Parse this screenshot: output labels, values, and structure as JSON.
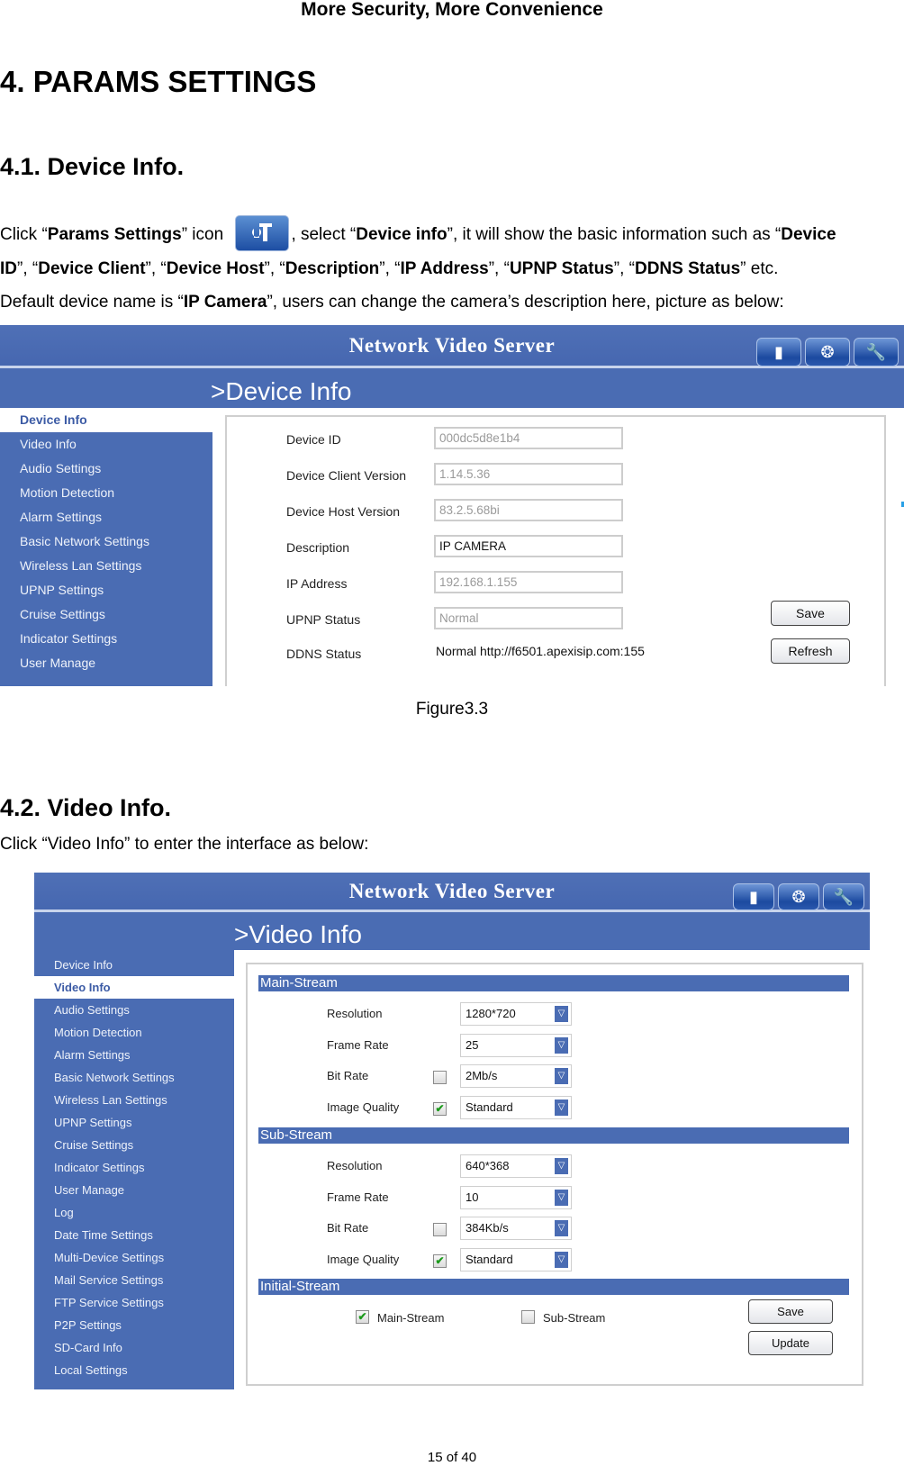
{
  "document": {
    "header": "More Security, More Convenience",
    "chapter_title": "4. PARAMS SETTINGS",
    "footer": "15 of 40"
  },
  "section1": {
    "title": "4.1. Device Info.",
    "para1": {
      "t1": "Click “",
      "b1": "Params Settings",
      "t2": "” icon ",
      "icon": "params-settings-icon",
      "t3": ", select “",
      "b2": "Device info",
      "t4": "”, it will show the basic information such as “",
      "b3": "Device"
    },
    "para2": {
      "b1": "ID",
      "t1": "”, “",
      "b2": "Device Client",
      "t2": "”, “",
      "b3": "Device Host",
      "t3": "”, “",
      "b4": "Description",
      "t4": "”, “",
      "b5": "IP Address",
      "t5": "”, “",
      "b6": "UPNP Status",
      "t6": "”, “",
      "b7": "DDNS Status",
      "t7": "” etc."
    },
    "para3": {
      "t1": "Default device name is “",
      "b1": "IP Camera",
      "t2": "”, users can change the camera’s description here, picture as below:"
    },
    "caption": "Figure3.3"
  },
  "section2": {
    "title": "4.2. Video Info.",
    "para": "Click “Video Info” to enter the interface as below:"
  },
  "app": {
    "title": "Network Video Server",
    "toolbar_icons": [
      "monitor-icon",
      "film-reel-icon",
      "tools-icon"
    ],
    "colors": {
      "primary": "#4a6cb3",
      "active_text": "#3c5ba5",
      "panel_border": "#cfcfcf"
    }
  },
  "figure1": {
    "section_title": ">Device Info",
    "sidebar": [
      "Device Info",
      "Video Info",
      "Audio Settings",
      "Motion Detection",
      "Alarm Settings",
      "Basic Network Settings",
      "Wireless Lan Settings",
      "UPNP Settings",
      "Cruise Settings",
      "Indicator Settings",
      "User Manage"
    ],
    "active_index": 0,
    "fields": [
      {
        "label": "Device ID",
        "value": "000dc5d8e1b4",
        "editable": false
      },
      {
        "label": "Device Client Version",
        "value": "1.14.5.36",
        "editable": false
      },
      {
        "label": "Device Host Version",
        "value": "83.2.5.68bi",
        "editable": false
      },
      {
        "label": "Description",
        "value": "IP CAMERA",
        "editable": true
      },
      {
        "label": "IP Address",
        "value": "192.168.1.155",
        "editable": false
      },
      {
        "label": "UPNP Status",
        "value": "Normal",
        "editable": false
      },
      {
        "label": "DDNS Status",
        "value": "Normal http://f6501.apexisip.com:155"
      }
    ],
    "buttons": {
      "save": "Save",
      "refresh": "Refresh"
    }
  },
  "figure2": {
    "section_title": ">Video Info",
    "sidebar": [
      "Device Info",
      "Video Info",
      "Audio Settings",
      "Motion Detection",
      "Alarm Settings",
      "Basic Network Settings",
      "Wireless Lan Settings",
      "UPNP Settings",
      "Cruise Settings",
      "Indicator Settings",
      "User Manage",
      "Log",
      "Date Time Settings",
      "Multi-Device Settings",
      "Mail Service Settings",
      "FTP Service Settings",
      "P2P Settings",
      "SD-Card Info",
      "Local Settings"
    ],
    "active_index": 1,
    "main_stream": {
      "title": "Main-Stream",
      "resolution": {
        "label": "Resolution",
        "value": "1280*720"
      },
      "frame_rate": {
        "label": "Frame Rate",
        "value": "25"
      },
      "bit_rate": {
        "label": "Bit Rate",
        "value": "2Mb/s",
        "checked": false
      },
      "image_quality": {
        "label": "Image Quality",
        "value": "Standard",
        "checked": true
      }
    },
    "sub_stream": {
      "title": "Sub-Stream",
      "resolution": {
        "label": "Resolution",
        "value": "640*368"
      },
      "frame_rate": {
        "label": "Frame Rate",
        "value": "10"
      },
      "bit_rate": {
        "label": "Bit Rate",
        "value": "384Kb/s",
        "checked": false
      },
      "image_quality": {
        "label": "Image Quality",
        "value": "Standard",
        "checked": true
      }
    },
    "initial_stream": {
      "title": "Initial-Stream",
      "main": {
        "label": "Main-Stream",
        "checked": true
      },
      "sub": {
        "label": "Sub-Stream",
        "checked": false
      }
    },
    "buttons": {
      "save": "Save",
      "update": "Update"
    }
  }
}
